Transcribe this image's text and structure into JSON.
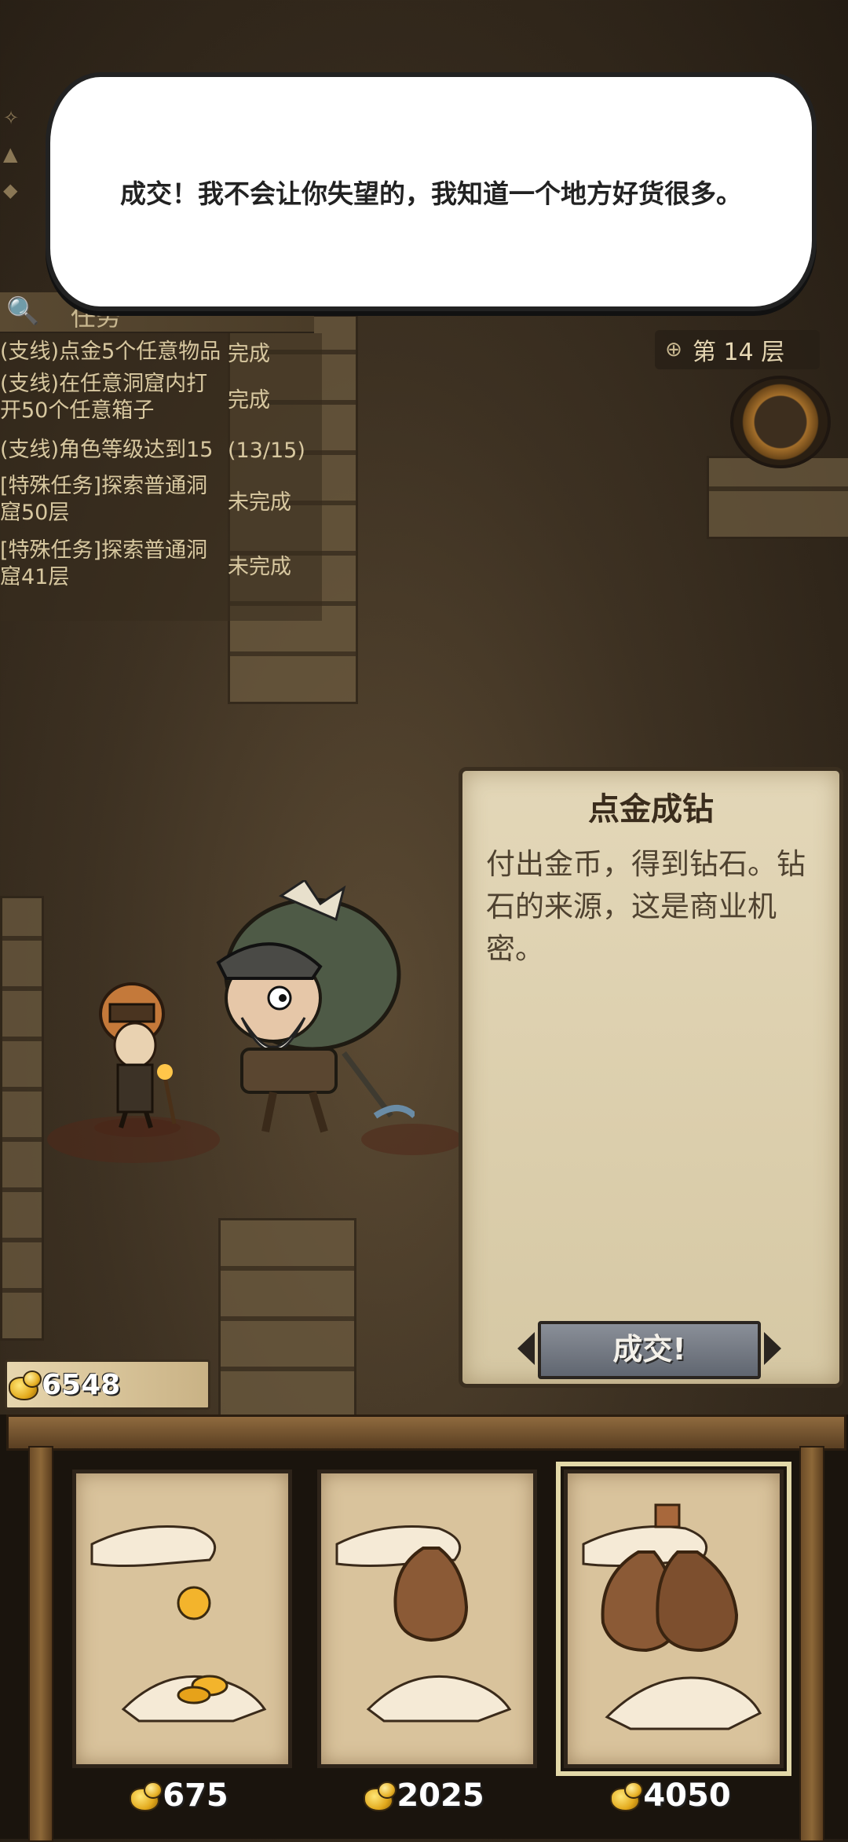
{
  "dialog": {
    "text": "成交！我不会让你失望的，我知道一个地方好货很多。"
  },
  "quest_panel": {
    "title": "任务",
    "quests": [
      {
        "name": "(支线)点金5个任意物品",
        "status": "完成"
      },
      {
        "name": "(支线)在任意洞窟内打开50个任意箱子",
        "status": "完成"
      },
      {
        "name": "(支线)角色等级达到15",
        "status": "(13/15)"
      },
      {
        "name": "[特殊任务]探索普通洞窟50层",
        "status": "未完成"
      },
      {
        "name": "[特殊任务]探索普通洞窟41层",
        "status": "未完成"
      }
    ]
  },
  "floor_indicator": {
    "label": "第 14 层"
  },
  "offer_panel": {
    "title": "点金成钻",
    "description": "付出金币，得到钻石。钻石的来源，这是商业机密。",
    "confirm_label": "成交!"
  },
  "gold": {
    "amount": "6548"
  },
  "shop": {
    "items": [
      {
        "price": "675",
        "icon": "single-coin-icon"
      },
      {
        "price": "2025",
        "icon": "coin-bag-icon"
      },
      {
        "price": "4050",
        "icon": "two-bags-icon",
        "selected": true
      }
    ]
  },
  "colors": {
    "gold": "#e2a91c",
    "panel": "#e3d7b8",
    "shelf": "#8f6a3e"
  }
}
